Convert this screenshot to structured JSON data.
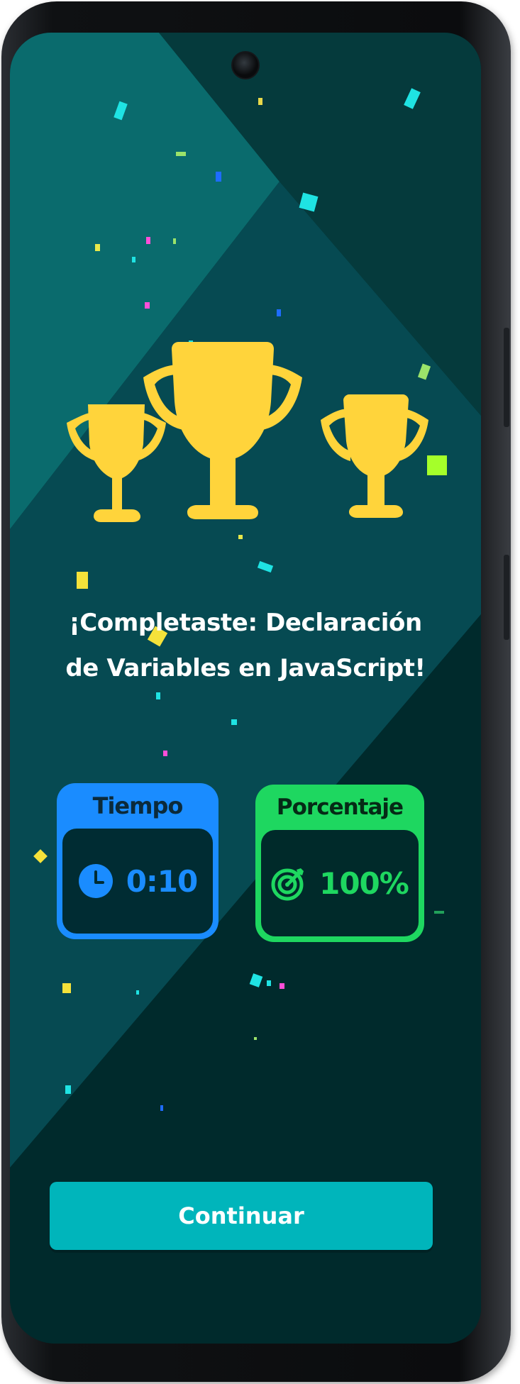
{
  "completion": {
    "title_line1": "¡Completaste: Declaración",
    "title_line2": "de Variables en JavaScript!"
  },
  "stats": {
    "time": {
      "label": "Tiempo",
      "value": "0:10",
      "icon": "clock-icon",
      "color": "#1a8cff"
    },
    "percentage": {
      "label": "Porcentaje",
      "value": "100%",
      "icon": "target-icon",
      "color": "#1ed760"
    }
  },
  "trophies": {
    "count": 3,
    "color": "#ffd43b"
  },
  "actions": {
    "continue_label": "Continuar",
    "continue_color": "#00b5bb"
  },
  "colors": {
    "background": "#002c2c",
    "background_light": "#0b5b5c",
    "text": "#ffffff"
  }
}
